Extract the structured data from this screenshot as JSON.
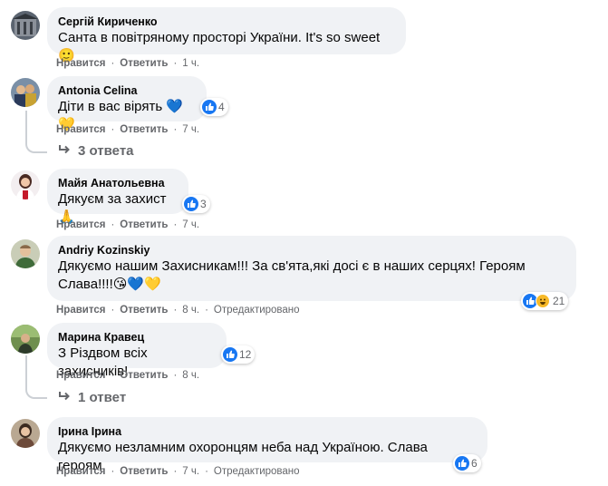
{
  "comments": [
    {
      "author": "Сергій Кириченко",
      "text": "Санта в повітряному просторі України. It's so sweet 🙂",
      "like": "Нравится",
      "reply": "Ответить",
      "time": "1 ч."
    },
    {
      "author": "Antonia Celina",
      "text": "Діти в вас вірять 💙💛",
      "reaction_count": "4",
      "like": "Нравится",
      "reply": "Ответить",
      "time": "7 ч.",
      "replies": "3 ответа"
    },
    {
      "author": "Майя Анатольевна",
      "text": "Дякуєм за захист🙏",
      "reaction_count": "3",
      "like": "Нравится",
      "reply": "Ответить",
      "time": "7 ч."
    },
    {
      "author": "Andriy Kozinskiy",
      "text_line1": "Дякуємо нашим Захисникам!!! За св'ята,які досі є в наших серцях! Героям",
      "text_line2": "Слава!!!!😘💙💛",
      "reaction_count": "21",
      "like": "Нравится",
      "reply": "Ответить",
      "time": "8 ч.",
      "edited": "Отредактировано"
    },
    {
      "author": "Марина Кравец",
      "text": "З Різдвом всіх захисників!",
      "reaction_count": "12",
      "like": "Нравится",
      "reply": "Ответить",
      "time": "8 ч.",
      "replies": "1 ответ"
    },
    {
      "author": "Ірина Ірина",
      "text": "Дякуємо незламним охоронцям неба над Україною. Слава героям.",
      "reaction_count": "6",
      "like": "Нравится",
      "reply": "Ответить",
      "time": "7 ч.",
      "edited": "Отредактировано"
    }
  ],
  "separator": "·",
  "colors": {
    "bubble": "#f0f2f5",
    "like_blue": "#1877f2",
    "meta_gray": "#65676b"
  }
}
